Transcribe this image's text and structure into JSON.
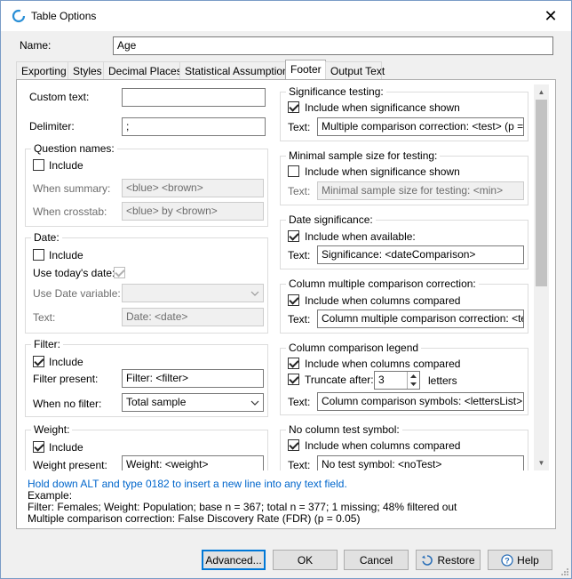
{
  "window": {
    "title": "Table Options",
    "close_glyph": "✕",
    "icon": "app-ring-icon"
  },
  "name": {
    "label": "Name:",
    "value": "Age"
  },
  "tabs": [
    {
      "label": "Exporting"
    },
    {
      "label": "Styles"
    },
    {
      "label": "Decimal Places"
    },
    {
      "label": "Statistical Assumptions"
    },
    {
      "label": "Footer"
    },
    {
      "label": "Output Text"
    }
  ],
  "active_tab": "Footer",
  "left": {
    "custom_text": {
      "label": "Custom text:",
      "value": ""
    },
    "delimiter": {
      "label": "Delimiter:",
      "value": ";"
    },
    "question_names": {
      "title": "Question names:",
      "include": {
        "label": "Include",
        "checked": false
      },
      "when_summary": {
        "label": "When summary:",
        "value": "<blue> <brown>"
      },
      "when_crosstab": {
        "label": "When crosstab:",
        "value": "<blue> by <brown>"
      }
    },
    "date": {
      "title": "Date:",
      "include": {
        "label": "Include",
        "checked": false
      },
      "use_today": {
        "label": "Use today's date:",
        "checked": true
      },
      "use_variable": {
        "label": "Use Date variable:",
        "value": ""
      },
      "text": {
        "label": "Text:",
        "value": "Date: <date>"
      }
    },
    "filter": {
      "title": "Filter:",
      "include": {
        "label": "Include",
        "checked": true
      },
      "present": {
        "label": "Filter present:",
        "value": "Filter: <filter>"
      },
      "no_filter": {
        "label": "When no filter:",
        "value": "Total sample"
      }
    },
    "weight": {
      "title": "Weight:",
      "include": {
        "label": "Include",
        "checked": true
      },
      "present": {
        "label": "Weight present:",
        "value": "Weight: <weight>"
      }
    }
  },
  "right": {
    "significance": {
      "title": "Significance testing:",
      "include": {
        "label": "Include when significance shown",
        "checked": true
      },
      "text": {
        "label": "Text:",
        "value": "Multiple comparison correction: <test> (p = <p>)"
      }
    },
    "min_sample": {
      "title": "Minimal sample size for testing:",
      "include": {
        "label": "Include when significance shown",
        "checked": false
      },
      "text": {
        "label": "Text:",
        "value": "Minimal sample size for testing: <min>"
      }
    },
    "date_sig": {
      "title": "Date significance:",
      "include": {
        "label": "Include when available:",
        "checked": true
      },
      "text": {
        "label": "Text:",
        "value": "Significance: <dateComparison>"
      }
    },
    "col_mult": {
      "title": "Column multiple comparison correction:",
      "include": {
        "label": "Include when columns compared",
        "checked": true
      },
      "text": {
        "label": "Text:",
        "value": "Column multiple comparison correction: <test>"
      }
    },
    "col_legend": {
      "title": "Column comparison legend",
      "include": {
        "label": "Include when columns compared",
        "checked": true
      },
      "truncate": {
        "label": "Truncate after:",
        "checked": true,
        "value": "3",
        "suffix": "letters"
      },
      "text": {
        "label": "Text:",
        "value": "Column comparison symbols: <lettersList>"
      }
    },
    "no_col": {
      "title": "No column test symbol:",
      "include": {
        "label": "Include when columns compared",
        "checked": true
      },
      "text": {
        "label": "Text:",
        "value": "No test symbol: <noTest>"
      }
    }
  },
  "hint": "Hold down ALT and type 0182 to insert a new line into any text field.",
  "example": {
    "label": "Example:",
    "line1": "Filter: Females; Weight: Population; base n = 367; total n = 377; 1 missing; 48% filtered out",
    "line2": "Multiple comparison correction: False Discovery Rate (FDR) (p = 0.05)"
  },
  "buttons": {
    "advanced": "Advanced...",
    "ok": "OK",
    "cancel": "Cancel",
    "restore": "Restore",
    "help": "Help"
  }
}
